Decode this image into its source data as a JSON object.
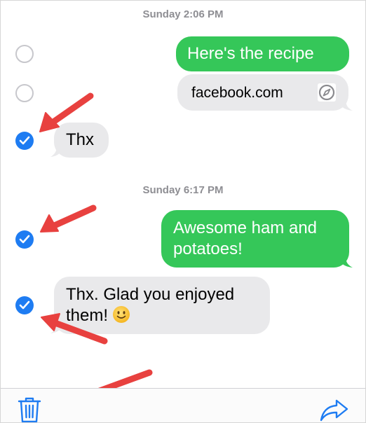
{
  "conversation": {
    "timestamps": [
      "Sunday 2:06 PM",
      "Sunday 6:17 PM"
    ],
    "messages": [
      {
        "direction": "outgoing",
        "text": "Here's the recipe",
        "selected": false
      },
      {
        "direction": "outgoing",
        "text": "facebook.com",
        "type": "link-preview",
        "icon": "compass-icon",
        "selected": false
      },
      {
        "direction": "incoming",
        "text": "Thx",
        "selected": true
      },
      {
        "direction": "outgoing",
        "text_lines": [
          "Awesome ham and",
          "potatoes!"
        ],
        "selected": true
      },
      {
        "direction": "incoming",
        "text_lines": [
          "Thx. Glad you enjoyed",
          "them!"
        ],
        "emoji": "slightly-smiling-face",
        "selected": true
      }
    ]
  },
  "toolbar": {
    "left_icon": "trash-icon",
    "right_icon": "share-arrow-icon"
  },
  "colors": {
    "outgoing_bubble": "#35c759",
    "incoming_bubble": "#e9e9eb",
    "selection_blue": "#1e7cf2",
    "annotation_arrow": "#e8413f",
    "timestamp": "#8e8e93",
    "toolbar_icon": "#1e7cf2"
  }
}
